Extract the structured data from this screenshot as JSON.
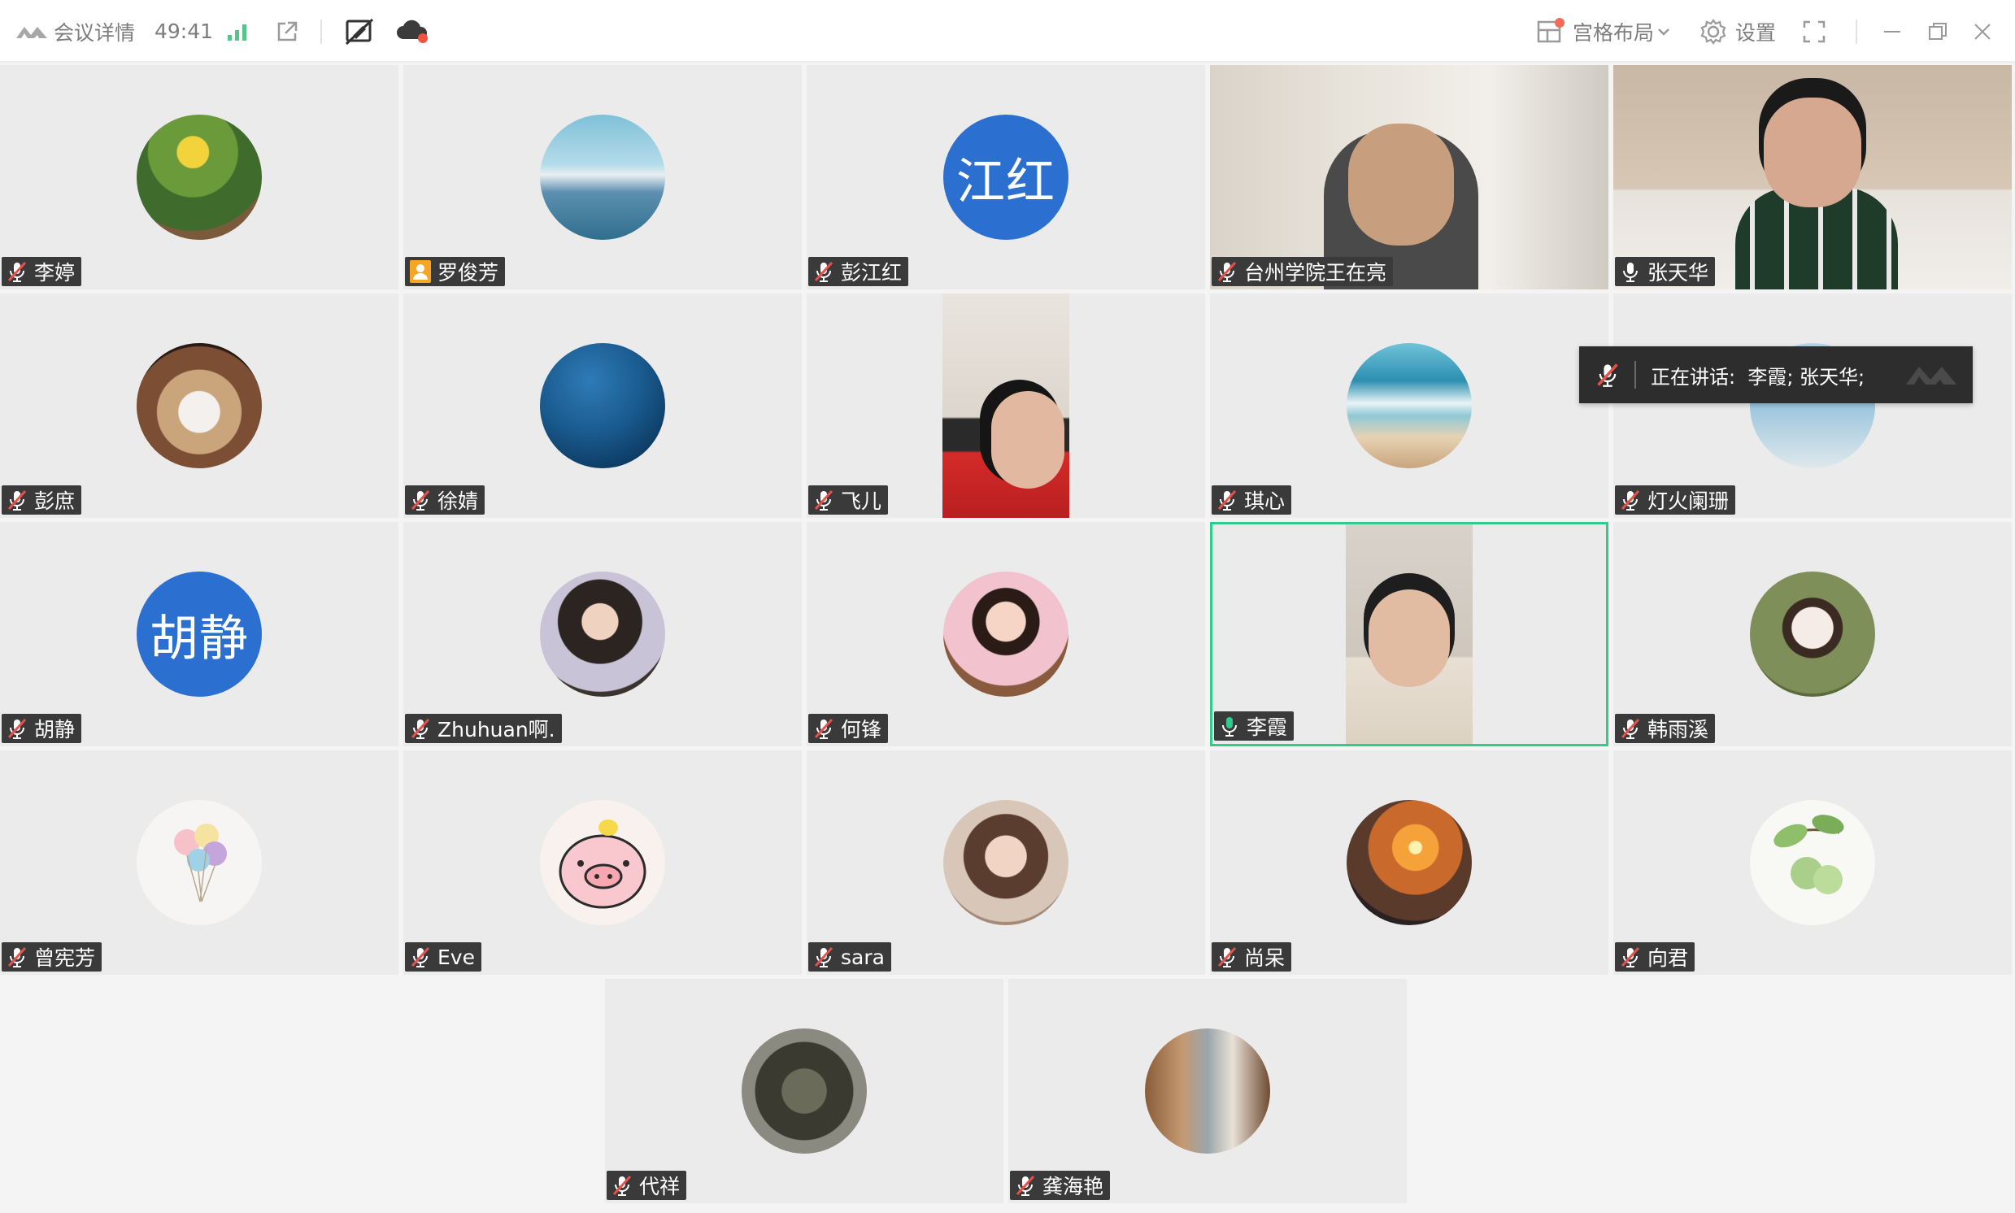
{
  "toolbar": {
    "meeting_details": "会议详情",
    "elapsed": "49:41",
    "layout_label": "宫格布局",
    "settings_label": "设置",
    "icons": [
      "tencent-meeting-logo-icon",
      "signal-bars-icon",
      "share-out-icon",
      "no-draw-icon",
      "cloud-record-icon",
      "grid-layout-icon",
      "chevron-down-icon",
      "gear-icon",
      "fullscreen-icon",
      "minimize-icon",
      "restore-icon",
      "close-icon"
    ]
  },
  "speaking": {
    "text": "正在讲话:  李霞; 张天华;"
  },
  "participants": [
    {
      "name": "李婷",
      "mic": "muted",
      "media": "avatar"
    },
    {
      "name": "罗俊芳",
      "mic": "host",
      "media": "avatar"
    },
    {
      "name": "彭江红",
      "mic": "muted",
      "media": "text-avatar",
      "avatar_text": "江红"
    },
    {
      "name": "台州学院王在亮",
      "mic": "muted",
      "media": "video"
    },
    {
      "name": "张天华",
      "mic": "on",
      "media": "video"
    },
    {
      "name": "彭庶",
      "mic": "muted",
      "media": "avatar"
    },
    {
      "name": "徐婧",
      "mic": "muted",
      "media": "avatar"
    },
    {
      "name": "飞儿",
      "mic": "muted",
      "media": "video-narrow"
    },
    {
      "name": "琪心",
      "mic": "muted",
      "media": "avatar"
    },
    {
      "name": "灯火阑珊",
      "mic": "muted",
      "media": "avatar"
    },
    {
      "name": "胡静",
      "mic": "muted",
      "media": "text-avatar",
      "avatar_text": "胡静"
    },
    {
      "name": "Zhuhuan啊.",
      "mic": "muted",
      "media": "avatar"
    },
    {
      "name": "何锋",
      "mic": "muted",
      "media": "avatar"
    },
    {
      "name": "李霞",
      "mic": "speaking",
      "media": "video-narrow",
      "active": true
    },
    {
      "name": "韩雨溪",
      "mic": "muted",
      "media": "avatar"
    },
    {
      "name": "曾宪芳",
      "mic": "muted",
      "media": "avatar"
    },
    {
      "name": "Eve",
      "mic": "muted",
      "media": "avatar"
    },
    {
      "name": "sara",
      "mic": "muted",
      "media": "avatar"
    },
    {
      "name": "尚呆",
      "mic": "muted",
      "media": "avatar"
    },
    {
      "name": "向君",
      "mic": "muted",
      "media": "avatar"
    },
    {
      "name": "代祥",
      "mic": "muted",
      "media": "avatar"
    },
    {
      "name": "龚海艳",
      "mic": "muted",
      "media": "avatar"
    }
  ],
  "colors": {
    "active_border": "#2fcc8b",
    "text_avatar_bg": "#2b6fd1",
    "host_badge": "#f6a623",
    "muted_mic": "#e8504a",
    "speaking_mic": "#2fcc8b"
  }
}
